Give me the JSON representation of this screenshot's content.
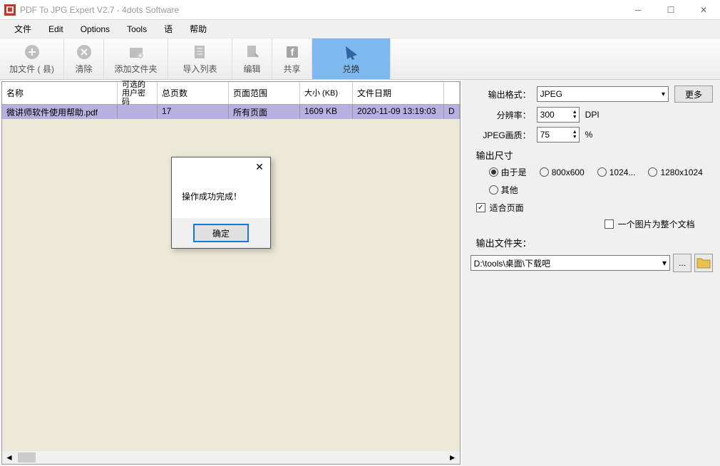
{
  "window": {
    "title": "PDF To JPG Expert V2.7 - 4dots Software"
  },
  "menu": [
    "文件",
    "Edit",
    "Options",
    "Tools",
    "语",
    "帮助"
  ],
  "toolbar": [
    {
      "label": "加文件 ( 县)",
      "icon": "add-file-icon"
    },
    {
      "label": "清除",
      "icon": "clear-icon"
    },
    {
      "label": "添加文件夹",
      "icon": "add-folder-icon"
    },
    {
      "label": "导入列表",
      "icon": "import-list-icon"
    },
    {
      "label": "编辑",
      "icon": "edit-icon"
    },
    {
      "label": "共享",
      "icon": "share-icon"
    },
    {
      "label": "兑换",
      "icon": "convert-icon",
      "active": true
    }
  ],
  "table": {
    "headers": [
      "名称",
      "可选的用户密码",
      "总页数",
      "页面范围",
      "大小 (KB)",
      "文件日期",
      ""
    ],
    "row": {
      "name": "微讲师软件使用帮助.pdf",
      "password": "",
      "pages": "17",
      "range": "所有页面",
      "size": "1609 KB",
      "date": "2020-11-09 13:19:03",
      "last": "D"
    }
  },
  "panel": {
    "format_label": "输出格式：",
    "format_value": "JPEG",
    "more_btn": "更多",
    "resolution_label": "分辨率：",
    "resolution_value": "300",
    "resolution_unit": "DPI",
    "quality_label": "JPEG画质：",
    "quality_value": "75",
    "quality_unit": "%",
    "size_label": "输出尺寸",
    "size_options": [
      "由于是",
      "800x600",
      "1024...",
      "1280x1024"
    ],
    "size_other": "其他",
    "fit_page": "适合页面",
    "one_per_doc": "一个图片为整个文档",
    "out_folder_label": "输出文件夹：",
    "out_folder_value": "D:\\tools\\桌面\\下载吧",
    "browse_btn": "..."
  },
  "dialog": {
    "message": "操作成功完成！",
    "ok": "确定"
  }
}
